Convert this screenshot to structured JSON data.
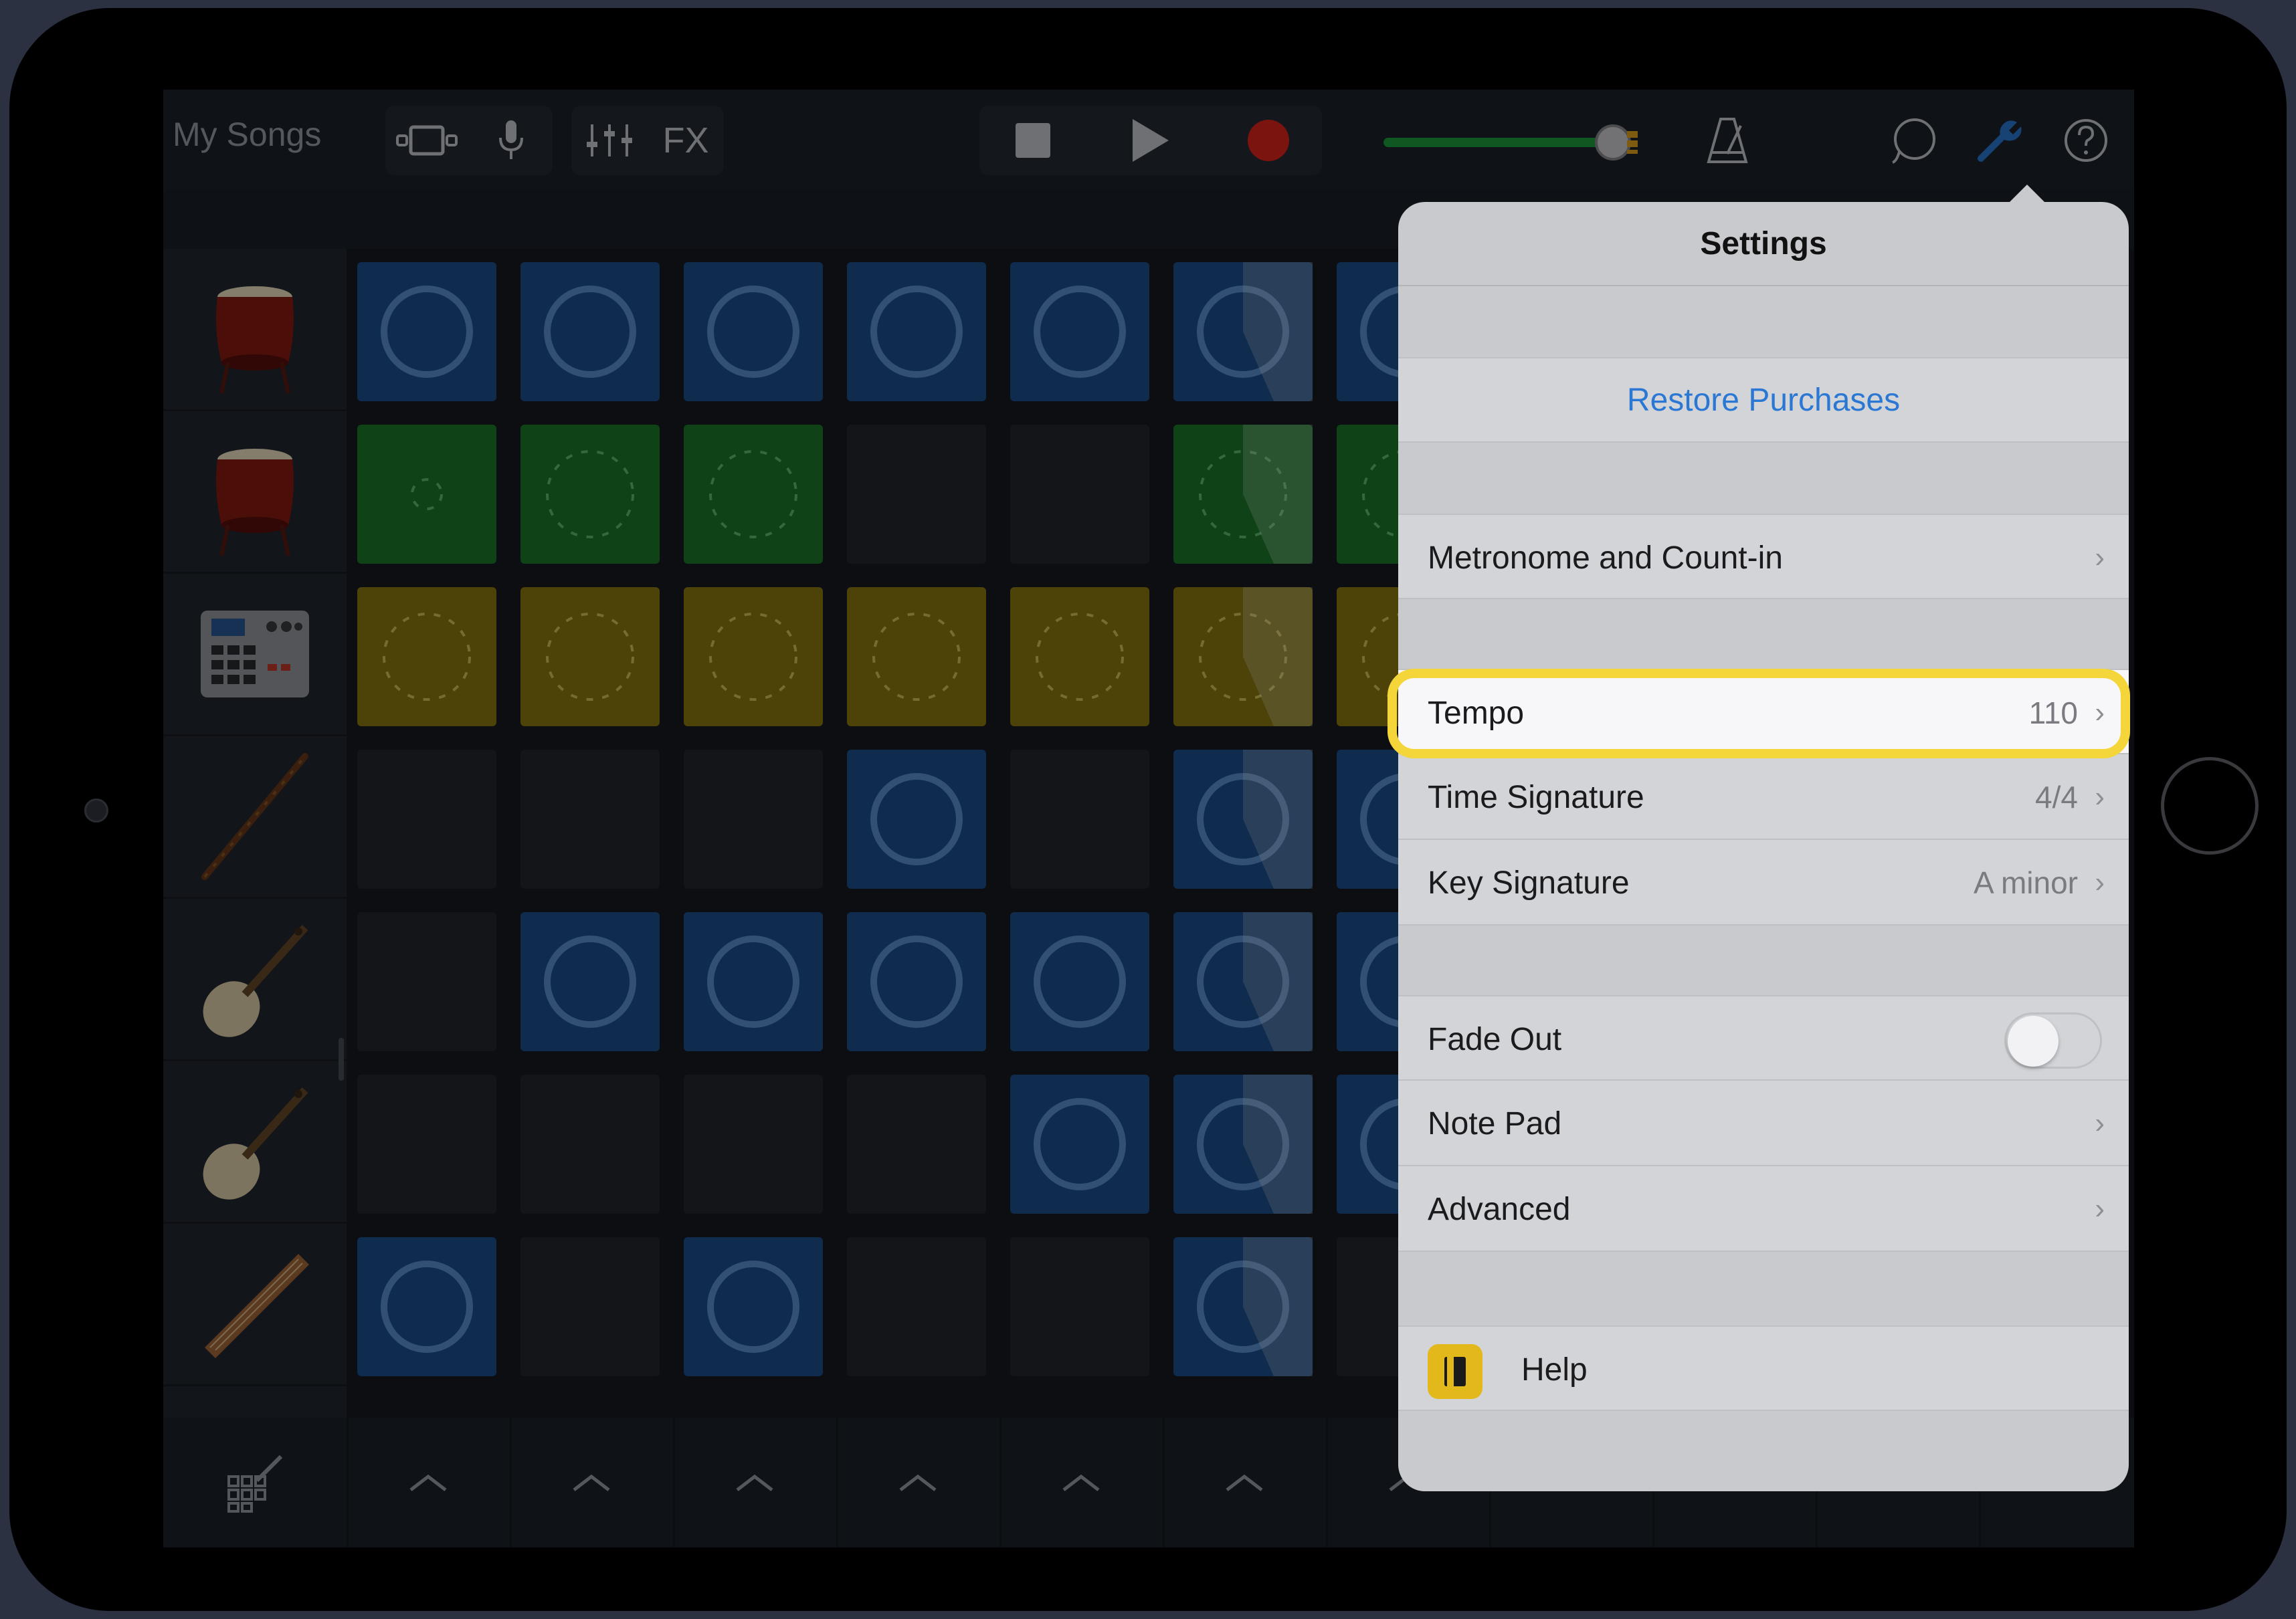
{
  "toolbar": {
    "my_songs": "My Songs",
    "fx_label": "FX",
    "volume_level": 0.85
  },
  "settings": {
    "title": "Settings",
    "restore": "Restore Purchases",
    "metronome": "Metronome and Count-in",
    "tempo_label": "Tempo",
    "tempo_value": "110",
    "time_sig_label": "Time Signature",
    "time_sig_value": "4/4",
    "key_sig_label": "Key Signature",
    "key_sig_value": "A minor",
    "fade_out_label": "Fade Out",
    "fade_out_on": false,
    "note_pad_label": "Note Pad",
    "advanced_label": "Advanced",
    "help_label": "Help"
  },
  "colors": {
    "accent_blue": "#2a78d4",
    "highlight_yellow": "#f4d63a",
    "record_red": "#e0241b",
    "cell_blue": "#1c4f8c",
    "cell_green": "#1c7a2a",
    "cell_yellow": "#8c7a12"
  },
  "tracks": [
    {
      "instrument": "drum-icon"
    },
    {
      "instrument": "drum-icon"
    },
    {
      "instrument": "drum-machine-icon"
    },
    {
      "instrument": "flute-icon"
    },
    {
      "instrument": "pipa-icon"
    },
    {
      "instrument": "pipa-icon"
    },
    {
      "instrument": "guzheng-icon"
    }
  ],
  "grid": [
    [
      "blue",
      "blue",
      "blue",
      "blue",
      "blue",
      "blue-play",
      "blue"
    ],
    [
      "green-small",
      "green",
      "green",
      "empty",
      "empty",
      "green-play",
      "green"
    ],
    [
      "yellow",
      "yellow",
      "yellow",
      "yellow",
      "yellow",
      "yellow-play",
      "yellow"
    ],
    [
      "empty",
      "empty",
      "empty",
      "blue",
      "empty",
      "blue-play",
      "blue"
    ],
    [
      "empty",
      "blue",
      "blue",
      "blue",
      "blue",
      "blue-play",
      "blue"
    ],
    [
      "empty",
      "empty",
      "empty",
      "empty",
      "blue",
      "blue-play",
      "blue"
    ],
    [
      "blue",
      "empty",
      "blue",
      "empty",
      "empty",
      "blue-play",
      "empty"
    ]
  ]
}
